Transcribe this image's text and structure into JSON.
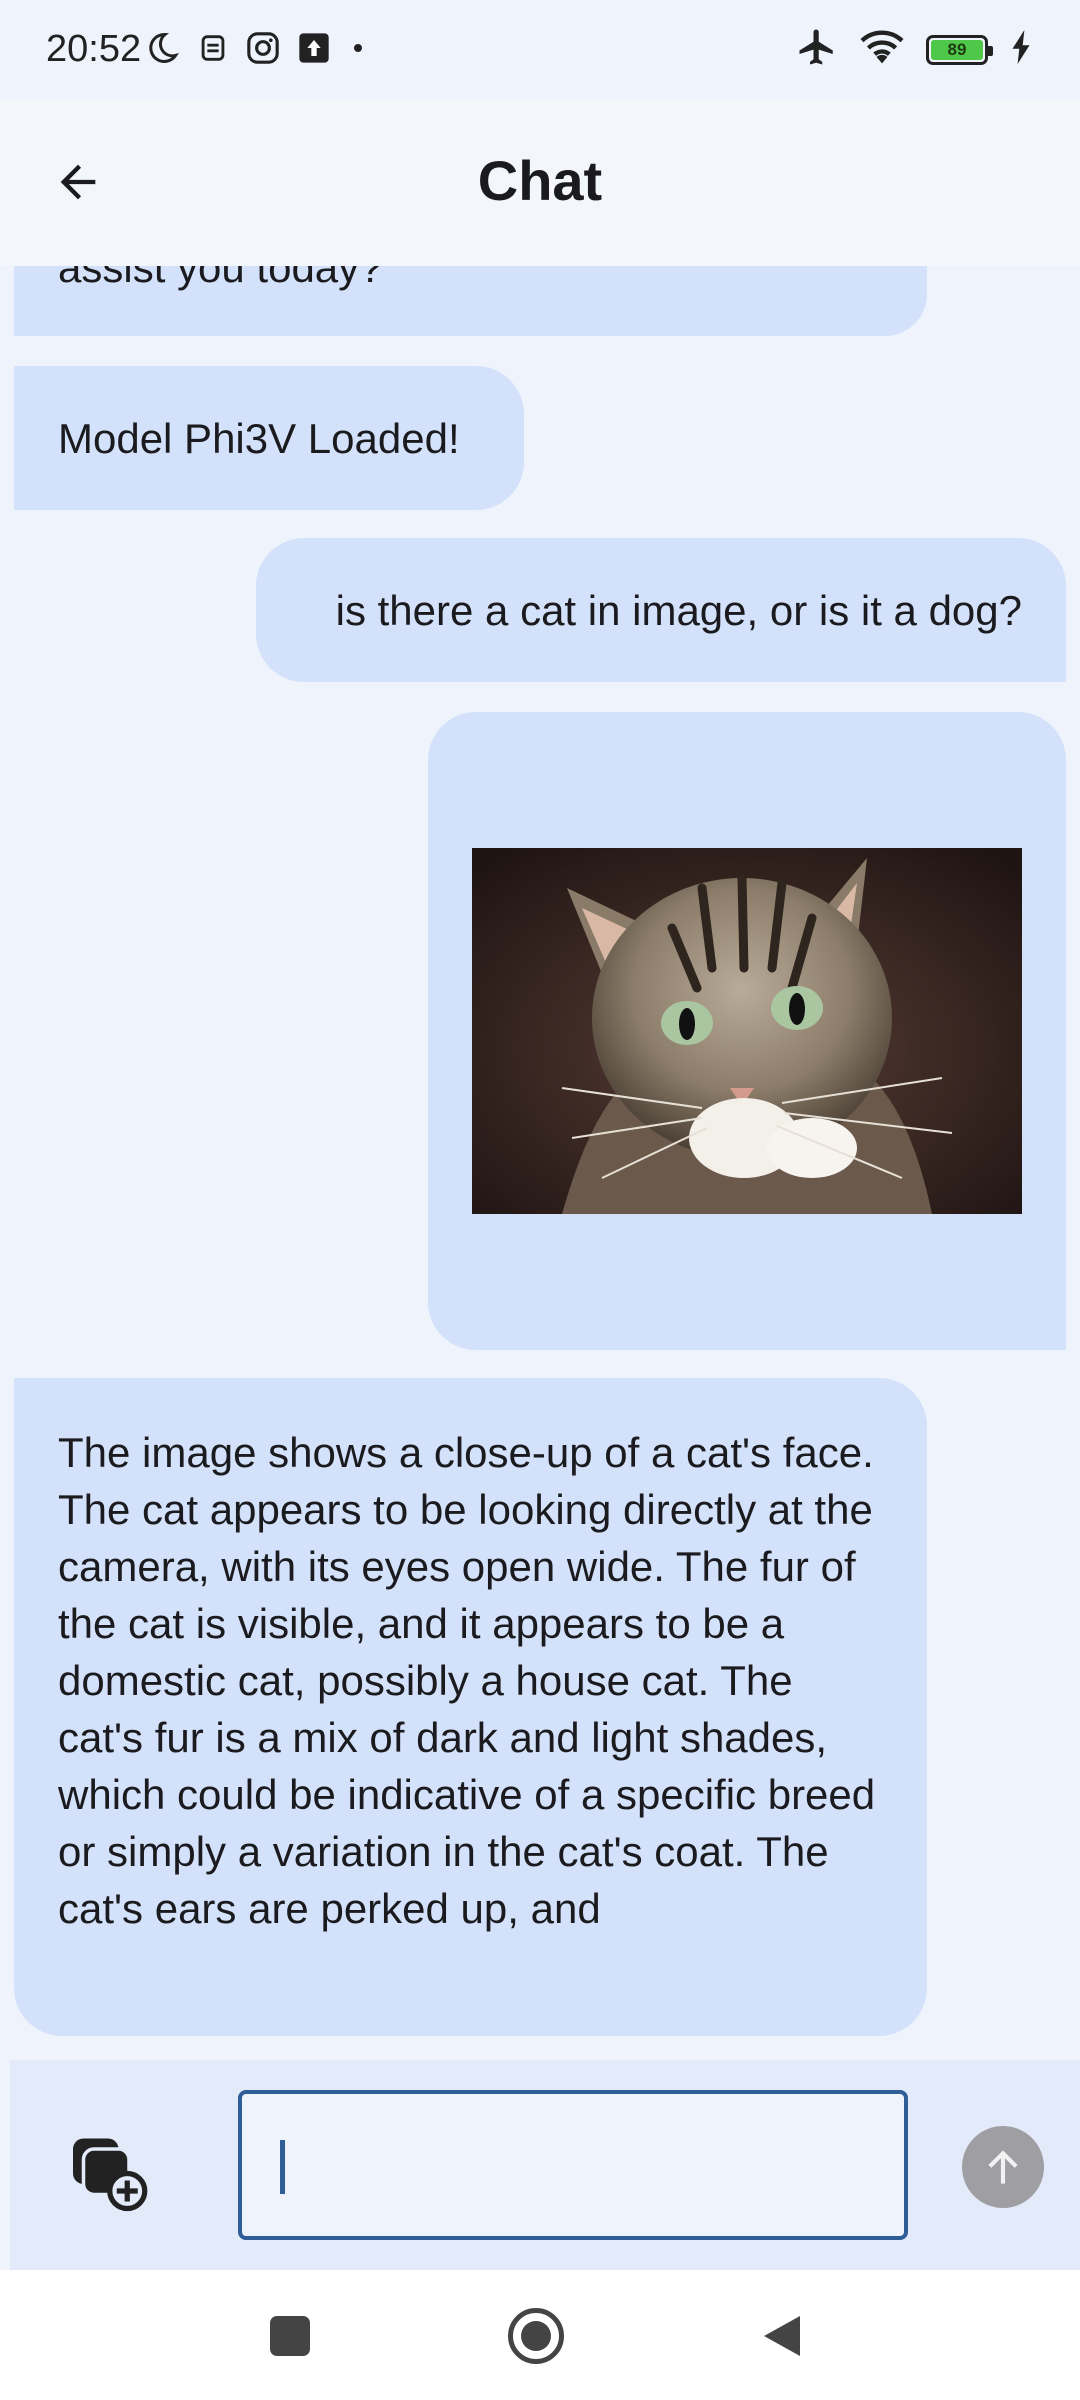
{
  "status_bar": {
    "time": "20:52",
    "battery_level": "89",
    "icons_left": [
      "moon-icon",
      "robot-icon",
      "instagram-icon",
      "upload-icon",
      "dot-icon"
    ],
    "icons_right": [
      "airplane-icon",
      "wifi-icon",
      "battery-icon",
      "charging-icon"
    ]
  },
  "app_bar": {
    "title": "Chat",
    "back_icon": "arrow-left-icon"
  },
  "messages": [
    {
      "role": "assistant",
      "text": "assist you today?"
    },
    {
      "role": "assistant",
      "text": "Model Phi3V Loaded!"
    },
    {
      "role": "user",
      "text": "is there a cat in image, or is it a dog?"
    },
    {
      "role": "user",
      "type": "image",
      "image_subject": "tabby cat looking up at camera"
    },
    {
      "role": "assistant",
      "text": "The image shows a close-up of a cat's face. The cat appears to be looking directly at the camera, with its eyes open wide. The fur of the cat is visible, and it appears to be a domestic cat, possibly a house cat. The cat's fur is a mix of dark and light shades, which could be indicative of a specific breed or simply a variation in the cat's coat. The cat's ears are perked up, and"
    }
  ],
  "input": {
    "value": "",
    "placeholder": "",
    "attach_icon": "add-image-icon",
    "send_icon": "arrow-up-icon"
  },
  "colors": {
    "background": "#eef3fc",
    "bubble": "#d3e2fa",
    "input_border": "#2f5d96",
    "send_disabled": "#9e9ea3"
  },
  "nav_bar": {
    "buttons": [
      "recents-icon",
      "home-icon",
      "back-icon"
    ]
  }
}
